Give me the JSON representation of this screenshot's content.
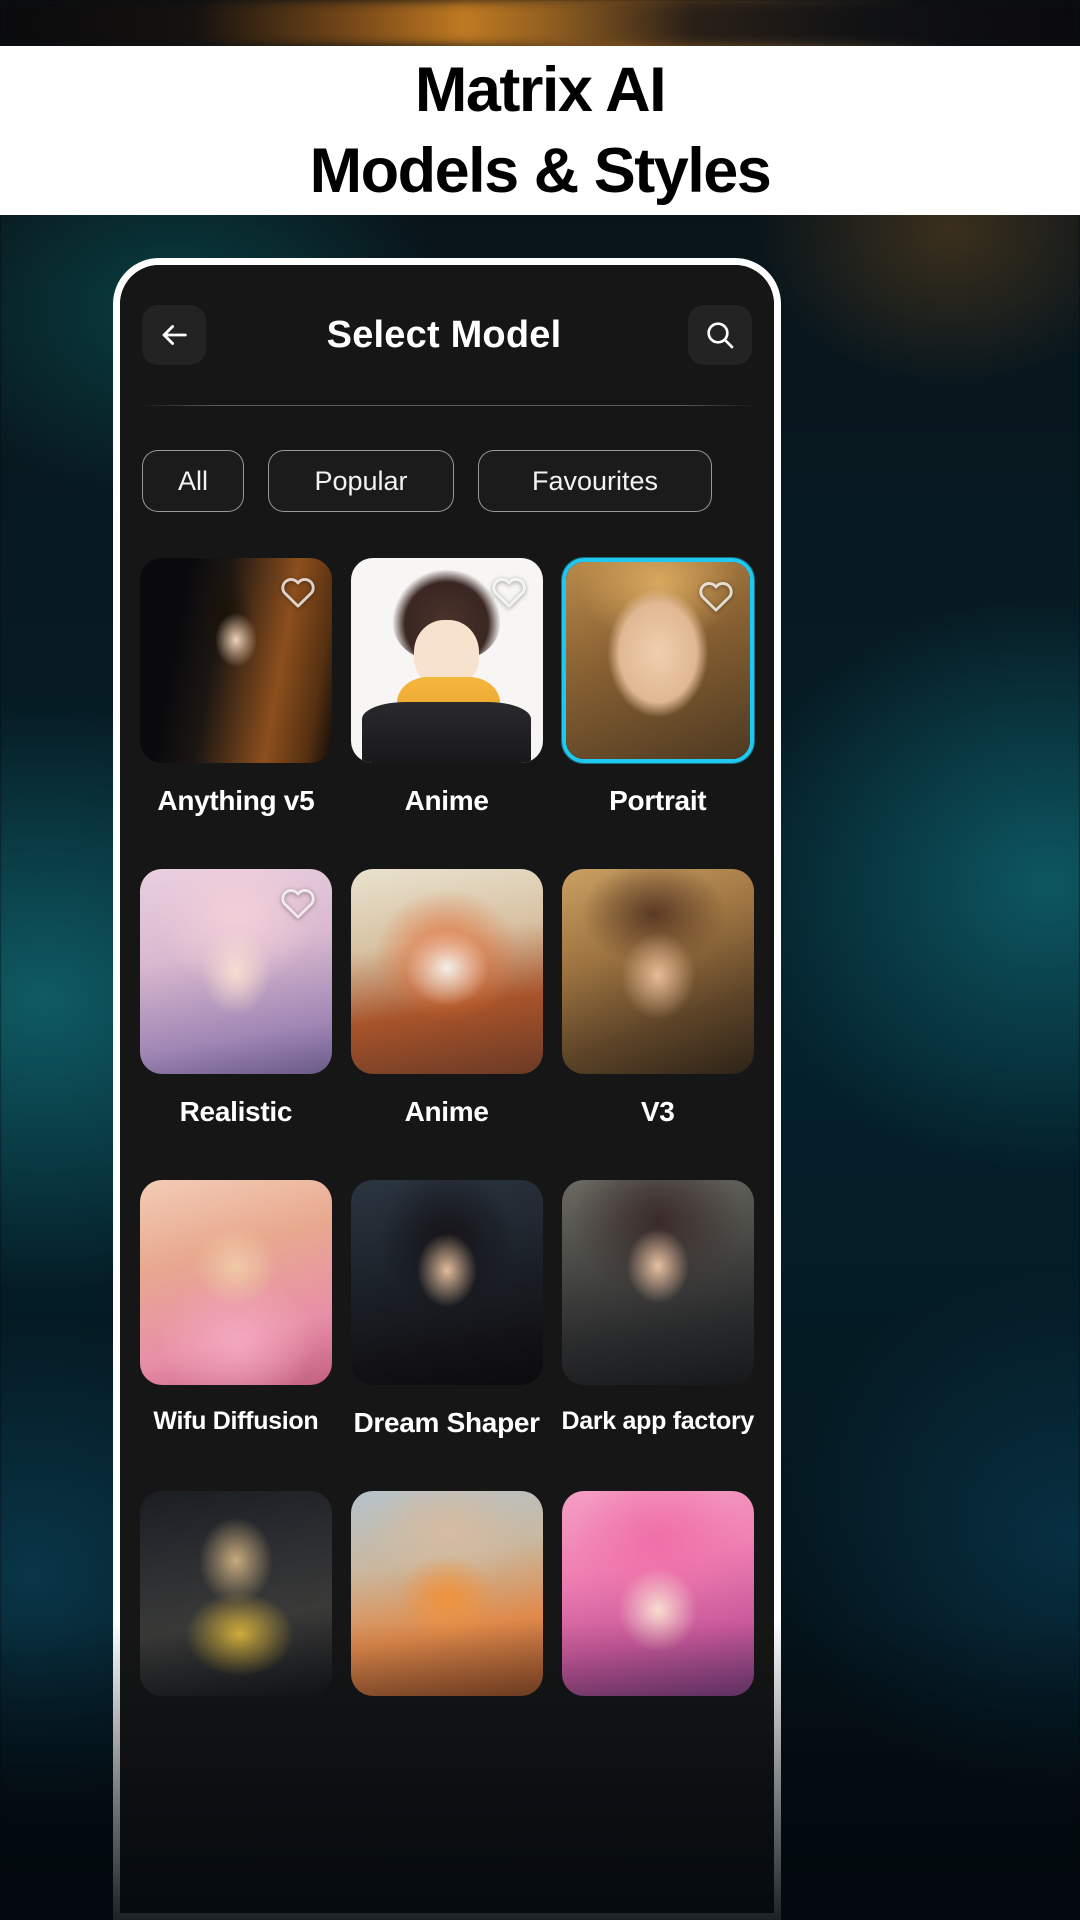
{
  "banner": {
    "line1": "Matrix AI",
    "line2": "Models & Styles"
  },
  "app": {
    "header": {
      "title": "Select Model",
      "back_icon": "arrow-left-icon",
      "search_icon": "search-icon"
    },
    "filters": [
      {
        "label": "All",
        "selected": false
      },
      {
        "label": "Popular",
        "selected": false
      },
      {
        "label": "Favourites",
        "selected": false
      }
    ],
    "models": [
      {
        "label": "Anything v5",
        "favourite": false,
        "selected": false,
        "heart": true,
        "art": "a-anything"
      },
      {
        "label": "Anime",
        "favourite": false,
        "selected": false,
        "heart": true,
        "art": "a-anime1"
      },
      {
        "label": "Portrait",
        "favourite": false,
        "selected": true,
        "heart": true,
        "art": "a-portrait"
      },
      {
        "label": "Realistic",
        "favourite": false,
        "selected": false,
        "heart": true,
        "art": "a-realistic"
      },
      {
        "label": "Anime",
        "favourite": false,
        "selected": false,
        "heart": false,
        "art": "a-anime2"
      },
      {
        "label": "V3",
        "favourite": false,
        "selected": false,
        "heart": false,
        "art": "a-v3"
      },
      {
        "label": "Wifu Diffusion",
        "favourite": false,
        "selected": false,
        "heart": false,
        "art": "a-wifu"
      },
      {
        "label": "Dream Shaper",
        "favourite": false,
        "selected": false,
        "heart": false,
        "art": "a-dream"
      },
      {
        "label": "Dark app factory",
        "favourite": false,
        "selected": false,
        "heart": false,
        "art": "a-dark"
      },
      {
        "label": "",
        "favourite": false,
        "selected": false,
        "heart": false,
        "art": "a-eagle"
      },
      {
        "label": "",
        "favourite": false,
        "selected": false,
        "heart": false,
        "art": "a-dino"
      },
      {
        "label": "",
        "favourite": false,
        "selected": false,
        "heart": false,
        "art": "a-pink"
      }
    ]
  },
  "colors": {
    "selected_border": "#1fc8f0",
    "banner_bg": "#ffffff",
    "banner_text": "#000000",
    "app_bg": "#161616",
    "chip_border": "#ffffff"
  }
}
